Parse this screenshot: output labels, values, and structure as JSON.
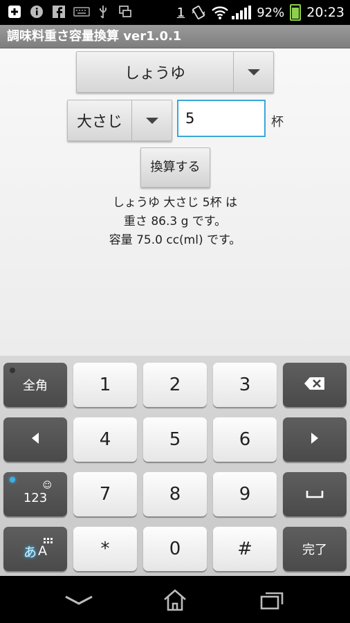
{
  "status_bar": {
    "icons_left": [
      "add-icon",
      "info-icon",
      "facebook-icon",
      "keyboard-icon",
      "usb-icon",
      "screen-icon"
    ],
    "sim_indicator": "1",
    "battery_percent": "92%",
    "time": "20:23",
    "battery_color": "#8fd14f"
  },
  "title": "調味料重さ容量換算 ver1.0.1",
  "form": {
    "ingredient": "しょうゆ",
    "measure": "大さじ",
    "amount_value": "5",
    "unit_label": "杯",
    "convert_button": "換算する",
    "input_border_color": "#37a7d8"
  },
  "result": {
    "line1": "しょうゆ 大さじ 5杯 は",
    "line2": "重さ 86.3 g です。",
    "line3": "容量 75.0 cc(ml) です。"
  },
  "keyboard": {
    "zenkaku": "全角",
    "num_mode": "123",
    "kana_a": "あ",
    "latin_a": "A",
    "done": "完了",
    "digits": [
      "1",
      "2",
      "3",
      "4",
      "5",
      "6",
      "7",
      "8",
      "9",
      "*",
      "0",
      "#"
    ],
    "accent_color": "#3ab0e8"
  }
}
